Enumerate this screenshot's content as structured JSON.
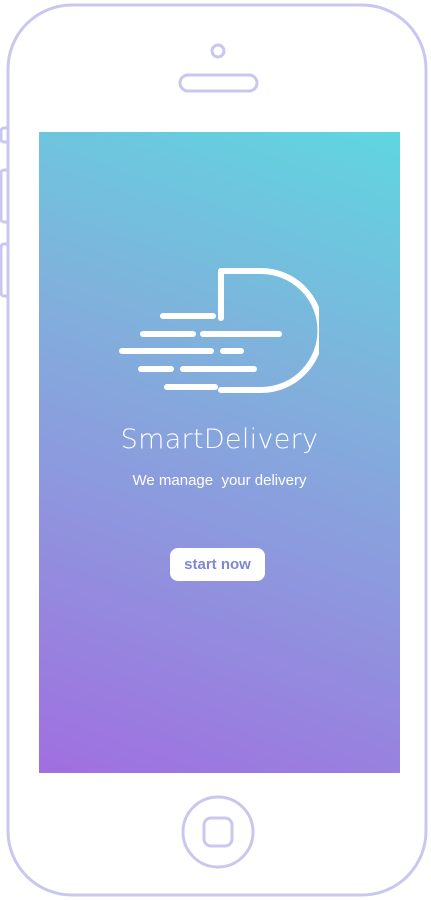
{
  "app": {
    "name": "SmartDelivery",
    "tagline": "We manage  your delivery"
  },
  "actions": {
    "start_label": "start now"
  },
  "colors": {
    "gradient_top_right": "#5fd6e0",
    "gradient_bottom_left": "#a06fe0",
    "button_background": "#ffffff",
    "button_text": "#7f86d6",
    "device_outline": "#c9c7ef"
  },
  "icons": {
    "logo": "speed-lines-d-logo-icon",
    "home_button": "home-square-icon"
  }
}
